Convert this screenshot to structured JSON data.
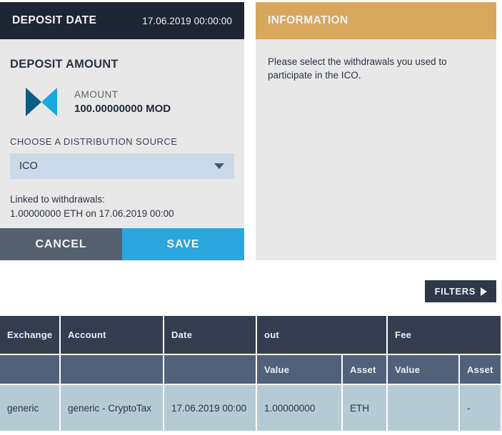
{
  "deposit_panel": {
    "header_title": "DEPOSIT DATE",
    "header_date": "17.06.2019 00:00:00",
    "section_title": "DEPOSIT AMOUNT",
    "amount_label": "AMOUNT",
    "amount_value": "100.00000000 MOD",
    "logo_name": "mod-token-logo",
    "field_label": "CHOOSE A DISTRIBUTION SOURCE",
    "select_value": "ICO",
    "linked_label": "Linked to withdrawals:",
    "linked_value": "1.00000000 ETH on 17.06.2019 00:00",
    "cancel_label": "CANCEL",
    "save_label": "SAVE"
  },
  "information_panel": {
    "header_title": "INFORMATION",
    "body_text": "Please select the withdrawals you used to participate in the ICO."
  },
  "filters": {
    "label": "FILTERS"
  },
  "table": {
    "group_headers": [
      {
        "label": "Exchange",
        "colspan": 1
      },
      {
        "label": "Account",
        "colspan": 1
      },
      {
        "label": "Date",
        "colspan": 1
      },
      {
        "label": "out",
        "colspan": 2
      },
      {
        "label": "Fee",
        "colspan": 2
      }
    ],
    "sub_headers": [
      "",
      "",
      "",
      "Value",
      "Asset",
      "Value",
      "Asset"
    ],
    "rows": [
      {
        "exchange": "generic",
        "account": "generic - CryptoTax",
        "date": "17.06.2019 00:00",
        "out_value": "1.00000000",
        "out_asset": "ETH",
        "fee_value": "",
        "fee_asset": "-"
      }
    ]
  },
  "colors": {
    "header_dark": "#1f2633",
    "info_gold": "#d7a75e",
    "panel_body": "#e8e8e8",
    "select_bg": "#ccd9e8",
    "cancel": "#55606e",
    "save": "#2ba6de",
    "table_head": "#333d4e",
    "table_subhead": "#52617a",
    "table_row": "#b5cbd3",
    "logo_dark": "#0d5c86",
    "logo_light": "#19a8e0"
  }
}
